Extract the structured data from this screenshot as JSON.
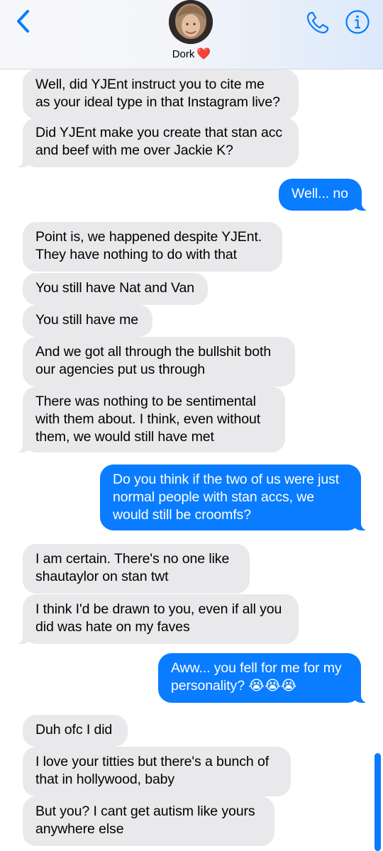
{
  "header": {
    "contact_name": "Dork",
    "contact_emoji": "❤️",
    "back_icon": "chevron-left-icon",
    "phone_icon": "phone-icon",
    "info_icon": "info-icon"
  },
  "colors": {
    "incoming_bubble": "#e9e9eb",
    "outgoing_bubble": "#0a7cff",
    "accent": "#0a7cff"
  },
  "messages": [
    {
      "from": "them",
      "text": "Well, did YJEnt instruct you to cite me\nas your ideal type in that Instagram live?"
    },
    {
      "from": "them",
      "text": "Did YJEnt make you create that stan acc\nand beef with me over Jackie K?"
    },
    {
      "from": "me",
      "text": "Well... no"
    },
    {
      "from": "them",
      "text": "Point is, we happened despite YJEnt.\nThey have nothing to do with that"
    },
    {
      "from": "them",
      "text": "You still have Nat and Van"
    },
    {
      "from": "them",
      "text": "You still have me"
    },
    {
      "from": "them",
      "text": "And we got all through the bullshit both\nour agencies put us through"
    },
    {
      "from": "them",
      "text": "There was nothing to be sentimental\nwith them about. I think, even without\nthem, we would still have met"
    },
    {
      "from": "me",
      "text": "Do you think if the two of us were just\nnormal people with stan accs, we\nwould still be croomfs?"
    },
    {
      "from": "them",
      "text": "I am certain. There's no one like\nshautaylor on stan twt"
    },
    {
      "from": "them",
      "text": "I think I'd be drawn to you, even if all you\ndid was hate on my faves"
    },
    {
      "from": "me",
      "text": "Aww... you fell for me for my\npersonality? 😭😭😭"
    },
    {
      "from": "them",
      "text": "Duh ofc I did"
    },
    {
      "from": "them",
      "text": "I love your titties but there's a bunch of\nthat in hollywood, baby"
    },
    {
      "from": "them",
      "text": "But you? I cant get autism like yours\nanywhere else"
    }
  ]
}
